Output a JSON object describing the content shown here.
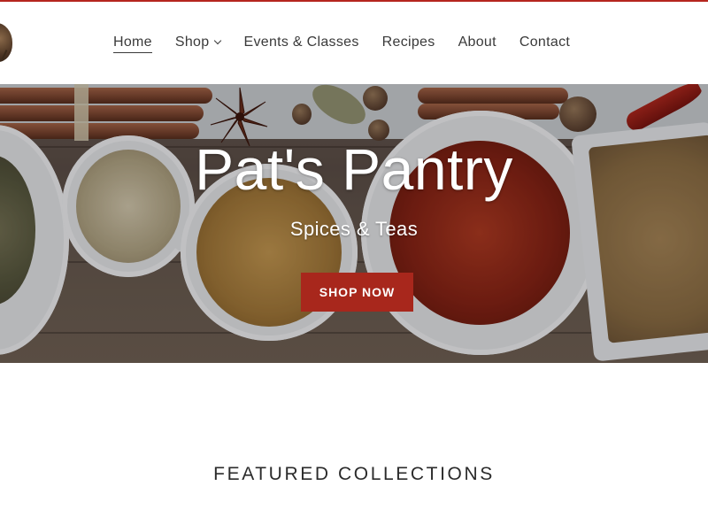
{
  "nav": {
    "items": [
      {
        "label": "Home",
        "active": true
      },
      {
        "label": "Shop",
        "has_dropdown": true
      },
      {
        "label": "Events & Classes"
      },
      {
        "label": "Recipes"
      },
      {
        "label": "About"
      },
      {
        "label": "Contact"
      }
    ]
  },
  "hero": {
    "title": "Pat's Pantry",
    "subtitle": "Spices & Teas",
    "cta_label": "SHOP NOW"
  },
  "featured": {
    "heading": "FEATURED COLLECTIONS"
  },
  "colors": {
    "accent": "#a8271c",
    "top_border": "#b5261e",
    "nav_text": "#3a3a3a",
    "heading_text": "#2b2b2b"
  },
  "icons": {
    "logo": "spice-logo-icon",
    "dropdown": "chevron-down-icon"
  }
}
